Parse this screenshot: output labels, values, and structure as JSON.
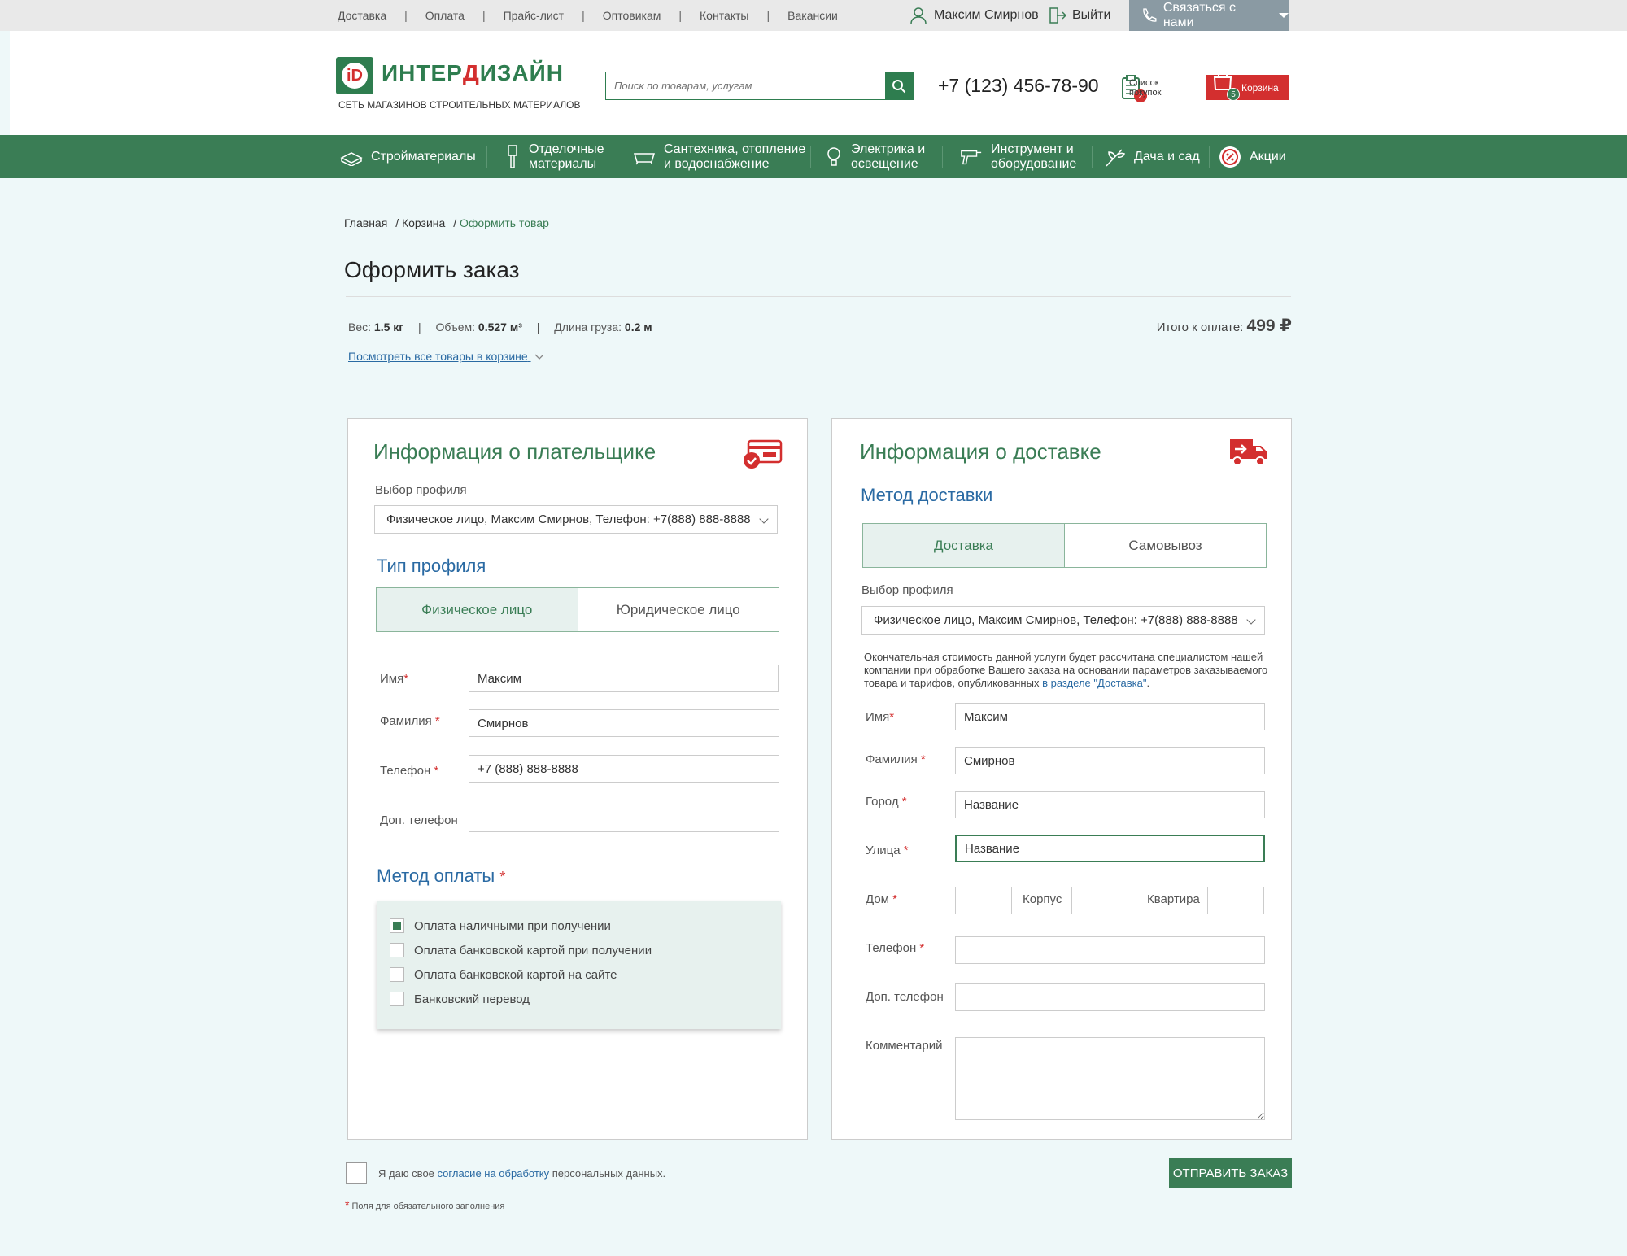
{
  "topnav": [
    "Доставка",
    "Оплата",
    "Прайс-лист",
    "Оптовикам",
    "Контакты",
    "Вакансии"
  ],
  "user": {
    "name": "Максим Смирнов",
    "logout": "Выйти",
    "contact": "Связаться с нами"
  },
  "logo": {
    "letters": "iD",
    "word_a": "ИНТЕР",
    "word_b": "Д",
    "word_c": "ИЗАЙН",
    "tagline": "СЕТЬ МАГАЗИНОВ СТРОИТЕЛЬНЫХ МАТЕРИАЛОВ"
  },
  "search": {
    "placeholder": "Поиск по товарам, услугам"
  },
  "phone": "+7 (123) 456-78-90",
  "wishlist": {
    "label_1": "Список",
    "label_2": "покупок",
    "count": "2"
  },
  "cart": {
    "label": "Корзина",
    "count": "5"
  },
  "mainnav": {
    "i0": "Стройматериалы",
    "i1a": "Отделочные",
    "i1b": "материалы",
    "i2a": "Сантехника, отопление",
    "i2b": "и водоснабжение",
    "i3a": "Электрика и",
    "i3b": "освещение",
    "i4a": "Инструмент и",
    "i4b": "оборудование",
    "i5": "Дача и сад",
    "i6": "Акции"
  },
  "breadcrumb": {
    "home": "Главная",
    "cart": "Корзина",
    "current": "Оформить товар",
    "sep": "/"
  },
  "page_title": "Оформить заказ",
  "params": {
    "weight_label": "Вес:",
    "weight": "1.5 кг",
    "volume_label": "Объем:",
    "volume": "0.527 м³",
    "length_label": "Длина груза:",
    "length": "0.2 м",
    "sep": "|"
  },
  "total": {
    "label": "Итого к оплате:",
    "value": "499 ₽"
  },
  "view_all": "Посмотреть все товары в корзине",
  "payer": {
    "title": "Информация о плательщике",
    "profile_label": "Выбор профиля",
    "profile_value": "Физическое лицо, Максим Смирнов, Телефон: +7(888) 888-8888",
    "type_title": "Тип профиля",
    "type_a": "Физическое лицо",
    "type_b": "Юридическое лицо",
    "name_label": "Имя",
    "name": "Максим",
    "surname_label": "Фамилия",
    "surname": "Смирнов",
    "phone_label": "Телефон",
    "phone": "+7 (888) 888-8888",
    "phone2_label": "Доп. телефон",
    "phone2": "",
    "pay_title": "Метод оплаты",
    "pay_options": [
      "Оплата наличными при получении",
      "Оплата банковской картой при получении",
      "Оплата банковской картой на сайте",
      "Банковский перевод"
    ]
  },
  "delivery": {
    "title": "Информация о доставке",
    "method_title": "Метод доставки",
    "method_a": "Доставка",
    "method_b": "Самовывоз",
    "profile_label": "Выбор профиля",
    "profile_value": "Физическое лицо, Максим Смирнов, Телефон: +7(888) 888-8888",
    "note_1": "Окончательная стоимость данной услуги будет рассчитана специалистом нашей",
    "note_2": "компании при обработке Вашего заказа на основании параметров заказываемого",
    "note_3": "товара и тарифов, опубликованных",
    "note_link": "в разделе \"Доставка\"",
    "note_end": ".",
    "name_label": "Имя",
    "name": "Максим",
    "surname_label": "Фамилия",
    "surname": "Смирнов",
    "city_label": "Город",
    "city": "Название",
    "street_label": "Улица",
    "street": "Название",
    "house_label": "Дом",
    "house": "",
    "block_label": "Корпус",
    "block": "",
    "flat_label": "Квартира",
    "flat": "",
    "phone_label": "Телефон",
    "phone": "",
    "phone2_label": "Доп. телефон",
    "phone2": "",
    "comment_label": "Комментарий",
    "comment": ""
  },
  "consent": {
    "text_a": "Я даю свое",
    "link": "согласие на обработку",
    "text_b": "персональных данных."
  },
  "required_note": {
    "star": "*",
    "text": "Поля для обязательного заполнения"
  },
  "required_mark": "*",
  "submit": "ОТПРАВИТЬ ЗАКАЗ",
  "colors": {
    "brand_green": "#3a7d55",
    "accent_red": "#d32f2f",
    "link_blue": "#2a6aa3",
    "background": "#eef8f9"
  }
}
